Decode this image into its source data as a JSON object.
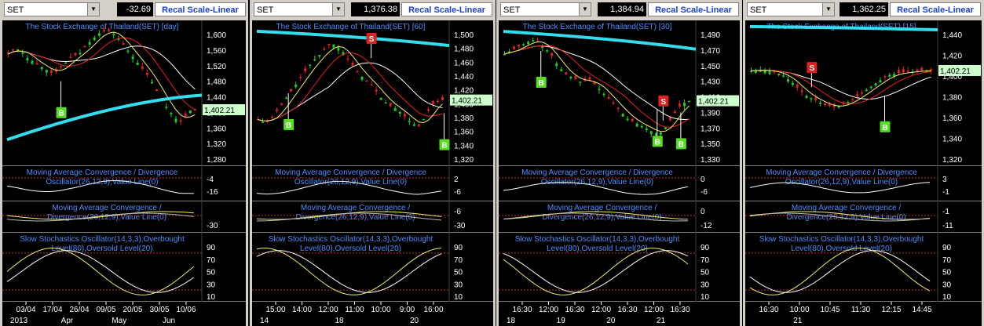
{
  "panels": [
    {
      "symbol": "SET",
      "value": "-32.69",
      "recal_label": "Recal Scale-Linear",
      "price_title": "The Stock Exchange of Thailand(SET) [day]",
      "price_ticks": [
        "1,600",
        "1,560",
        "1,520",
        "1,480",
        "1,440",
        "1,400",
        "1,360",
        "1,320",
        "1,280"
      ],
      "last_price": "1,402.21",
      "signals": [
        {
          "label": "B",
          "type": "buy"
        }
      ],
      "macd1_title": [
        "Moving Average Convergence / Divergence",
        "Oscillator(26,12,9),Value Line(0)"
      ],
      "macd1_ticks": [
        "-4",
        "-16"
      ],
      "macd2_title": [
        "Moving Average Convergence /",
        "Divergence(26,12,9),Value Line(0)"
      ],
      "macd2_ticks": [
        "-30"
      ],
      "stoch_title": [
        "Slow Stochastics Oscillator(14,3,3),Overbought",
        "Level(80),Oversold Level(20)"
      ],
      "stoch_ticks": [
        "90",
        "70",
        "50",
        "30",
        "10"
      ],
      "x_ticks": [
        "03/04",
        "17/04",
        "26/04",
        "09/05",
        "20/05",
        "30/05",
        "10/06"
      ],
      "x_ticks2": [
        "2013",
        "Apr",
        "May",
        "Jun"
      ]
    },
    {
      "symbol": "SET",
      "value": "1,376.38",
      "recal_label": "Recal Scale-Linear",
      "price_title": "The Stock Exchange of Thailand(SET) [60]",
      "price_ticks": [
        "1,500",
        "1,480",
        "1,460",
        "1,440",
        "1,420",
        "1,400",
        "1,380",
        "1,360",
        "1,340",
        "1,320"
      ],
      "last_price": "1,402.21",
      "signals": [
        {
          "label": "B",
          "type": "buy"
        },
        {
          "label": "S",
          "type": "sell"
        },
        {
          "label": "B",
          "type": "buy"
        }
      ],
      "macd1_title": [
        "Moving Average Convergence / Divergence",
        "Oscillator(26,12,9),Value Line(0)"
      ],
      "macd1_ticks": [
        "2",
        "-6"
      ],
      "macd2_title": [
        "Moving Average Convergence /",
        "Divergence(26,12,9),Value Line(0)"
      ],
      "macd2_ticks": [
        "-6",
        "-30"
      ],
      "stoch_title": [
        "Slow Stochastics Oscillator(14,3,3),Overbought",
        "Level(80),Oversold Level(20)"
      ],
      "stoch_ticks": [
        "90",
        "70",
        "50",
        "30",
        "10"
      ],
      "x_ticks": [
        "15:00",
        "14:00",
        "12:00",
        "11:00",
        "10:00",
        "9:00",
        "16:00"
      ],
      "x_ticks2": [
        "14",
        "18",
        "20"
      ]
    },
    {
      "symbol": "SET",
      "value": "1,384.94",
      "recal_label": "Recal Scale-Linear",
      "price_title": "The Stock Exchange of Thailand(SET) [30]",
      "price_ticks": [
        "1,490",
        "1,470",
        "1,450",
        "1,430",
        "1,410",
        "1,390",
        "1,370",
        "1,350",
        "1,330"
      ],
      "last_price": "1,402.21",
      "signals": [
        {
          "label": "B",
          "type": "buy"
        },
        {
          "label": "S",
          "type": "sell"
        },
        {
          "label": "B",
          "type": "buy"
        },
        {
          "label": "B",
          "type": "buy"
        }
      ],
      "macd1_title": [
        "Moving Average Convergence / Divergence",
        "Oscillator(26,12,9),Value Line(0)"
      ],
      "macd1_ticks": [
        "0",
        "-6"
      ],
      "macd2_title": [
        "Moving Average Convergence /",
        "Divergence(26,12,9),Value Line(0)"
      ],
      "macd2_ticks": [
        "0",
        "-12"
      ],
      "stoch_title": [
        "Slow Stochastics Oscillator(14,3,3),Overbought",
        "Level(80),Oversold Level(20)"
      ],
      "stoch_ticks": [
        "90",
        "70",
        "50",
        "30",
        "10"
      ],
      "x_ticks": [
        "16:30",
        "12:00",
        "16:30",
        "12:00",
        "16:30",
        "12:00",
        "16:30"
      ],
      "x_ticks2": [
        "18",
        "19",
        "20",
        "21"
      ]
    },
    {
      "symbol": "SET",
      "value": "1,362.25",
      "recal_label": "Recal Scale-Linear",
      "price_title": "The Stock Exchange of Thailand(SET) [15]",
      "price_ticks": [
        "1,440",
        "1,420",
        "1,400",
        "1,380",
        "1,360",
        "1,340",
        "1,320"
      ],
      "last_price": "1,402.21",
      "signals": [
        {
          "label": "S",
          "type": "sell"
        },
        {
          "label": "B",
          "type": "buy"
        }
      ],
      "macd1_title": [
        "Moving Average Convergence / Divergence",
        "Oscillator(26,12,9),Value Line(0)"
      ],
      "macd1_ticks": [
        "3",
        "-1"
      ],
      "macd2_title": [
        "Moving Average Convergence /",
        "Divergence(26,12,9),Value Line(0)"
      ],
      "macd2_ticks": [
        "-1",
        "-11"
      ],
      "stoch_title": [
        "Slow Stochastics Oscillator(14,3,3),Overbought",
        "Level(80),Oversold Level(20)"
      ],
      "stoch_ticks": [
        "90",
        "70",
        "50",
        "30",
        "10"
      ],
      "x_ticks": [
        "16:30",
        "10:00",
        "10:45",
        "11:30",
        "12:15",
        "14:45"
      ],
      "x_ticks2": [
        "21"
      ]
    }
  ],
  "chart_data": [
    {
      "type": "line",
      "title": "The Stock Exchange of Thailand(SET) [day]",
      "ylim": [
        1280,
        1600
      ],
      "series": [
        {
          "name": "SET",
          "values": [
            1540,
            1555,
            1548,
            1530,
            1520,
            1510,
            1500,
            1490,
            1505,
            1520,
            1535,
            1540,
            1560,
            1575,
            1590,
            1600,
            1595,
            1580,
            1560,
            1540,
            1520,
            1500,
            1480,
            1450,
            1420,
            1400,
            1380,
            1370,
            1400,
            1402
          ]
        }
      ]
    },
    {
      "type": "line",
      "title": "The Stock Exchange of Thailand(SET) [60]",
      "ylim": [
        1320,
        1500
      ],
      "series": [
        {
          "name": "SET",
          "values": [
            1375,
            1370,
            1380,
            1395,
            1410,
            1425,
            1440,
            1455,
            1465,
            1478,
            1480,
            1470,
            1455,
            1440,
            1430,
            1420,
            1405,
            1395,
            1390,
            1380,
            1370,
            1365,
            1385,
            1400,
            1402
          ]
        }
      ]
    },
    {
      "type": "line",
      "title": "The Stock Exchange of Thailand(SET) [30]",
      "ylim": [
        1330,
        1490
      ],
      "series": [
        {
          "name": "SET",
          "values": [
            1460,
            1465,
            1470,
            1475,
            1478,
            1470,
            1460,
            1445,
            1435,
            1430,
            1425,
            1428,
            1420,
            1410,
            1400,
            1390,
            1380,
            1375,
            1370,
            1365,
            1360,
            1370,
            1385,
            1398,
            1402
          ]
        }
      ]
    },
    {
      "type": "line",
      "title": "The Stock Exchange of Thailand(SET) [15]",
      "ylim": [
        1320,
        1440
      ],
      "series": [
        {
          "name": "SET",
          "values": [
            1402,
            1403,
            1401,
            1398,
            1390,
            1380,
            1375,
            1370,
            1368,
            1372,
            1378,
            1385,
            1392,
            1398,
            1400,
            1401,
            1402,
            1402
          ]
        }
      ]
    }
  ],
  "colors": {
    "frame": "#d4d0c8",
    "title": "#4f8cff",
    "buy": "#55dd22",
    "sell": "#e02020",
    "ema_long": "#33ddee",
    "ma_red": "#ee2020",
    "ma_yellow": "#f0f060",
    "ma_white": "#ffffff",
    "candle_up": "#22cc22",
    "candle_down": "#dd2222",
    "label_bg": "#ccffcc"
  }
}
